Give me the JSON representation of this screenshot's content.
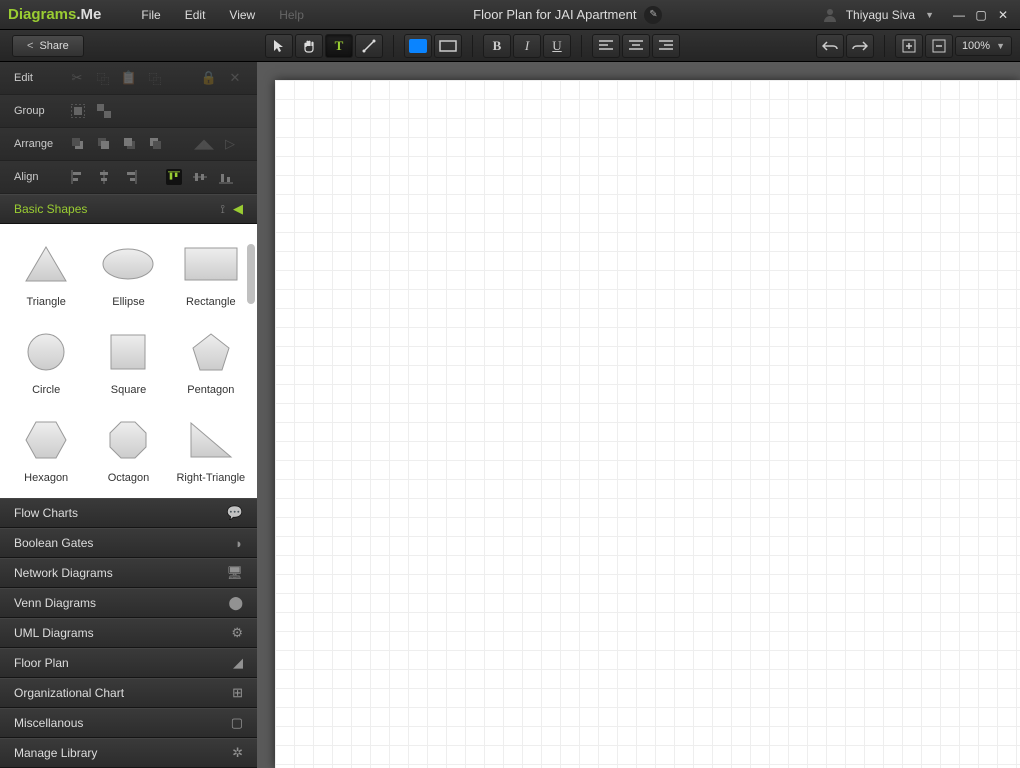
{
  "app": {
    "logo1": "Diagrams",
    "logo2": ".Me"
  },
  "menu": {
    "file": "File",
    "edit": "Edit",
    "view": "View",
    "help": "Help"
  },
  "document": {
    "title": "Floor Plan for JAI Apartment"
  },
  "user": {
    "name": "Thiyagu Siva"
  },
  "share": {
    "label": "Share"
  },
  "zoom": {
    "value": "100%"
  },
  "panels": {
    "edit": "Edit",
    "group": "Group",
    "arrange": "Arrange",
    "align": "Align"
  },
  "accordion": {
    "basic_shapes": "Basic Shapes"
  },
  "shapes": [
    {
      "name": "Triangle",
      "kind": "triangle"
    },
    {
      "name": "Ellipse",
      "kind": "ellipse"
    },
    {
      "name": "Rectangle",
      "kind": "rectangle"
    },
    {
      "name": "Circle",
      "kind": "circle"
    },
    {
      "name": "Square",
      "kind": "square"
    },
    {
      "name": "Pentagon",
      "kind": "pentagon"
    },
    {
      "name": "Hexagon",
      "kind": "hexagon"
    },
    {
      "name": "Octagon",
      "kind": "octagon"
    },
    {
      "name": "Right-Triangle",
      "kind": "rtriangle"
    }
  ],
  "categories": [
    {
      "label": "Flow Charts",
      "icon": "💬"
    },
    {
      "label": "Boolean Gates",
      "icon": "◗"
    },
    {
      "label": "Network Diagrams",
      "icon": "🖥"
    },
    {
      "label": "Venn Diagrams",
      "icon": "⬤"
    },
    {
      "label": "UML Diagrams",
      "icon": "⚙"
    },
    {
      "label": "Floor Plan",
      "icon": "◢"
    },
    {
      "label": "Organizational Chart",
      "icon": "⊞"
    },
    {
      "label": "Miscellanous",
      "icon": "▢"
    },
    {
      "label": "Manage Library",
      "icon": "✲"
    }
  ]
}
